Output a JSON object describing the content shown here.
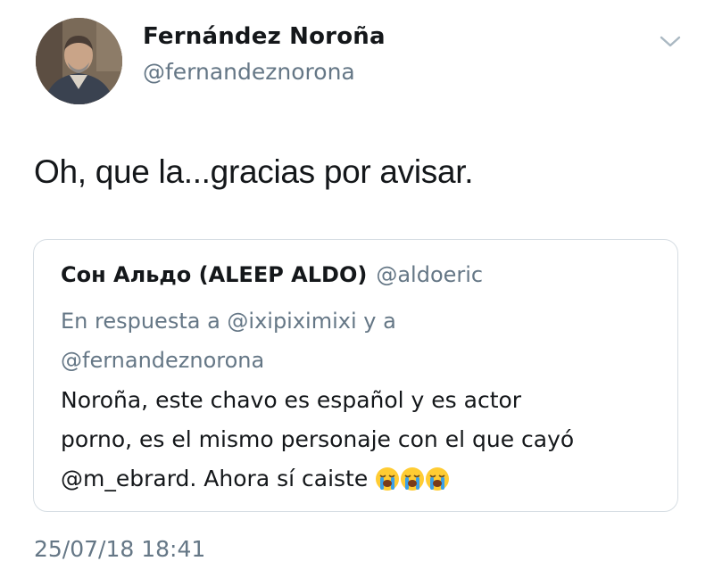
{
  "tweet": {
    "author": {
      "display_name": "Fernández Noroña",
      "handle": "@fernandeznorona",
      "avatar_icon": "profile-photo"
    },
    "menu_icon": "chevron-down-icon",
    "text": "Oh, que la...gracias por avisar.",
    "timestamp": "25/07/18 18:41"
  },
  "quoted_tweet": {
    "display_name": "Сон Альдо (ALEEP ALDO)",
    "handle": "@aldoeric",
    "reply_line_1": "En respuesta a @ixipiximixi y a",
    "reply_line_2": "@fernandeznorona",
    "body_line_1": "Noroña, este chavo es español y es actor",
    "body_line_2": "porno, es el mismo personaje con el que cayó",
    "body_line_3": "@m_ebrard. Ahora sí caiste",
    "emojis": [
      "loudly-crying-face",
      "loudly-crying-face",
      "loudly-crying-face"
    ]
  },
  "colors": {
    "text_primary": "#14171a",
    "text_secondary": "#657786",
    "card_border": "#d6dde3",
    "emoji_yellow": "#ffcc33",
    "tear_blue": "#3aa0e8"
  }
}
